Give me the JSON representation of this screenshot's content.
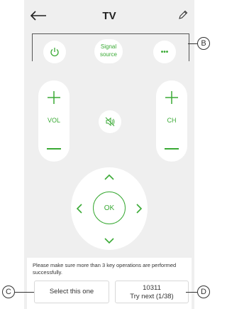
{
  "header": {
    "title": "TV"
  },
  "remote": {
    "signal_source_label": "Signal source",
    "more_label": "•••",
    "vol_label": "VOL",
    "ch_label": "CH",
    "ok_label": "OK"
  },
  "footer": {
    "hint": "Please make sure more than 3 key operations are performed successfully.",
    "select_label": "Select this one",
    "next_code": "10311",
    "next_label": "Try next (1/38)"
  },
  "callouts": {
    "b": "B",
    "c": "C",
    "d": "D"
  },
  "colors": {
    "accent": "#3aaa35",
    "background": "#efefef",
    "surface": "#ffffff"
  },
  "icons": [
    "back-arrow-icon",
    "edit-pencil-icon",
    "power-icon",
    "more-icon",
    "plus-icon",
    "minus-icon",
    "mute-icon",
    "arrow-up-icon",
    "arrow-down-icon",
    "arrow-left-icon",
    "arrow-right-icon"
  ]
}
